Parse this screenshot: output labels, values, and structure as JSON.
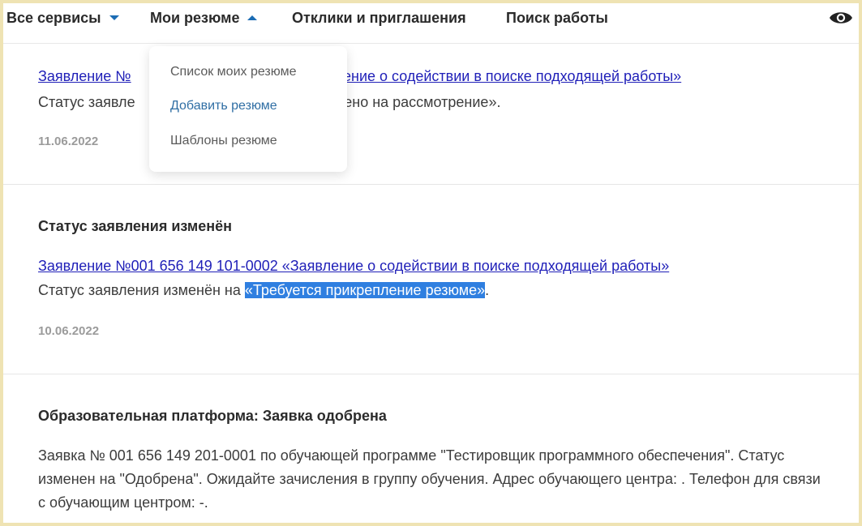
{
  "nav": {
    "all_services": "Все сервисы",
    "my_resumes": "Мои резюме",
    "responses": "Отклики и приглашения",
    "job_search": "Поиск работы"
  },
  "dropdown": {
    "items": [
      "Список моих резюме",
      "Добавить резюме",
      "Шаблоны резюме"
    ]
  },
  "notifications": [
    {
      "link_before": "Заявление №",
      "link_after": "аявление о содействии в поиске подходящей работы»",
      "status_before": "Статус заявле",
      "status_after": "авлено на рассмотрение».",
      "date": "11.06.2022"
    },
    {
      "title": "Статус заявления изменён",
      "link": "Заявление №001 656 149 101-0002 «Заявление о содействии в поиске подходящей работы»",
      "status_prefix": "Статус заявления изменён на ",
      "status_value": "«Требуется прикрепление резюме»",
      "status_suffix": ".",
      "date": "10.06.2022"
    },
    {
      "title": "Образовательная платформа: Заявка одобрена",
      "text": "Заявка № 001 656 149 201-0001 по обучающей программе \"Тестировщик программного обеспечения\". Статус изменен на \"Одобрена\". Ожидайте зачисления в группу обучения. Адрес обучающего центра: . Телефон для связи с обучающим центром: -."
    }
  ],
  "colors": {
    "accent": "#1b6cb4",
    "link": "#1f1fb8",
    "selection": "#2f7fe0",
    "frame": "#efe3b3"
  },
  "icons": {
    "visibility": "eye-icon",
    "all_services_caret": "chevron-down-icon",
    "my_resumes_caret": "chevron-up-icon"
  }
}
